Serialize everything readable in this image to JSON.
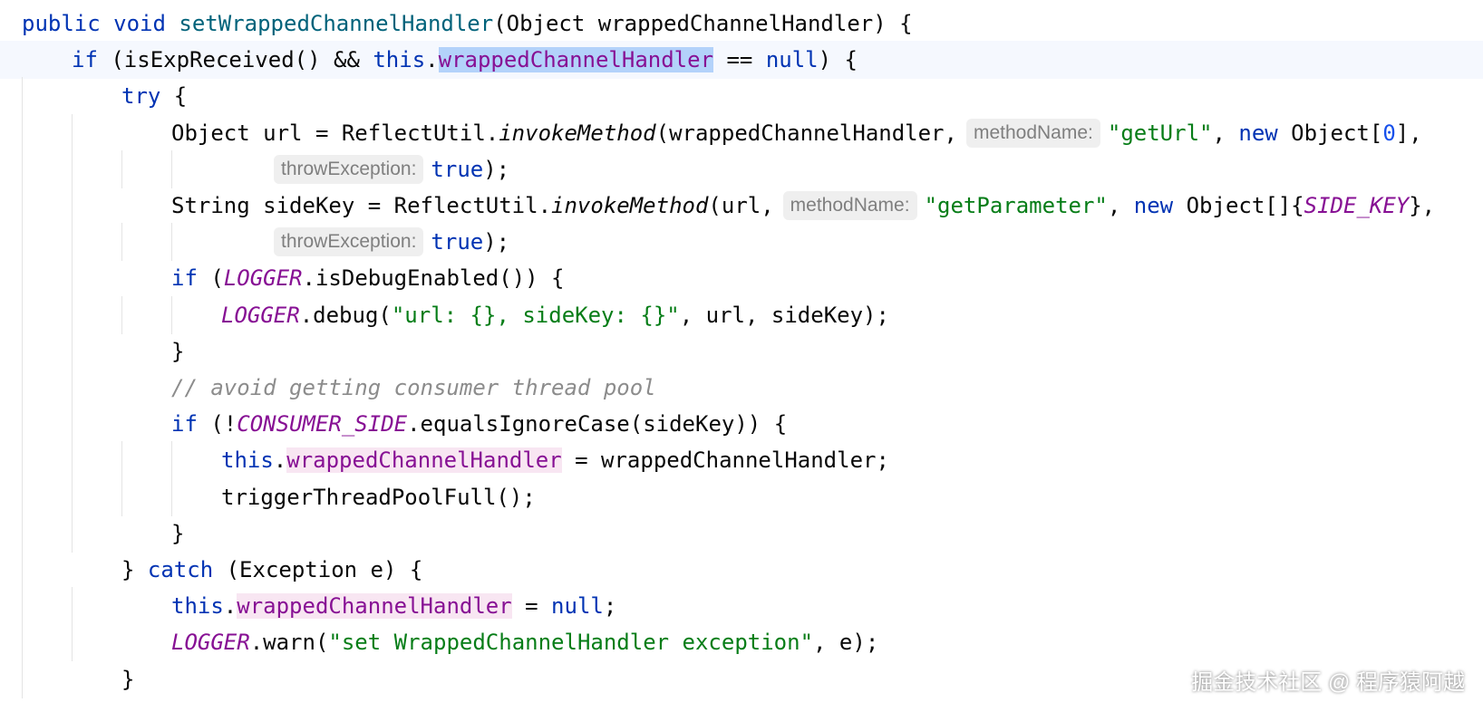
{
  "editor": {
    "lines": [
      {
        "segments": [
          {
            "t": "public",
            "c": "kw"
          },
          {
            "t": " "
          },
          {
            "t": "void",
            "c": "kw"
          },
          {
            "t": " "
          },
          {
            "t": "setWrappedChannelHandler",
            "c": "fn"
          },
          {
            "t": "(Object wrappedChannelHandler) {"
          }
        ]
      },
      {
        "current": true,
        "segments": [
          {
            "t": "if",
            "c": "kw"
          },
          {
            "t": " (isExpReceived() && "
          },
          {
            "t": "this",
            "c": "kw"
          },
          {
            "t": "."
          },
          {
            "t": "wrappedChannelHandler",
            "c": "fld sel"
          },
          {
            "t": " == "
          },
          {
            "t": "null",
            "c": "kw"
          },
          {
            "t": ") {"
          }
        ]
      },
      {
        "segments": [
          {
            "t": "try",
            "c": "kw"
          },
          {
            "t": " {"
          }
        ]
      },
      {
        "segments": [
          {
            "t": "Object url = ReflectUtil."
          },
          {
            "t": "invokeMethod",
            "c": "it"
          },
          {
            "t": "(wrappedChannelHandler,"
          },
          {
            "t": "methodName:",
            "c": "hint"
          },
          {
            "t": "\"getUrl\"",
            "c": "str"
          },
          {
            "t": ", "
          },
          {
            "t": "new",
            "c": "kw"
          },
          {
            "t": " Object["
          },
          {
            "t": "0",
            "c": "num"
          },
          {
            "t": "],"
          }
        ]
      },
      {
        "segments": [
          {
            "t": "throwException:",
            "c": "hint first"
          },
          {
            "t": "true",
            "c": "kw"
          },
          {
            "t": ");"
          }
        ]
      },
      {
        "segments": [
          {
            "t": "String sideKey = ReflectUtil."
          },
          {
            "t": "invokeMethod",
            "c": "it"
          },
          {
            "t": "(url,"
          },
          {
            "t": "methodName:",
            "c": "hint"
          },
          {
            "t": "\"getParameter\"",
            "c": "str"
          },
          {
            "t": ", "
          },
          {
            "t": "new",
            "c": "kw"
          },
          {
            "t": " Object[]{"
          },
          {
            "t": "SIDE_KEY",
            "c": "cnst"
          },
          {
            "t": "},"
          }
        ]
      },
      {
        "segments": [
          {
            "t": "throwException:",
            "c": "hint first"
          },
          {
            "t": "true",
            "c": "kw"
          },
          {
            "t": ");"
          }
        ]
      },
      {
        "segments": [
          {
            "t": "if",
            "c": "kw"
          },
          {
            "t": " ("
          },
          {
            "t": "LOGGER",
            "c": "cnst"
          },
          {
            "t": ".isDebugEnabled()) {"
          }
        ]
      },
      {
        "segments": [
          {
            "t": "LOGGER",
            "c": "cnst"
          },
          {
            "t": ".debug("
          },
          {
            "t": "\"url: {}, sideKey: {}\"",
            "c": "str"
          },
          {
            "t": ", url, sideKey);"
          }
        ]
      },
      {
        "segments": [
          {
            "t": "}"
          }
        ]
      },
      {
        "segments": [
          {
            "t": "// avoid getting consumer thread pool",
            "c": "cm"
          }
        ]
      },
      {
        "segments": [
          {
            "t": "if",
            "c": "kw"
          },
          {
            "t": " (!"
          },
          {
            "t": "CONSUMER_SIDE",
            "c": "cnst"
          },
          {
            "t": ".equalsIgnoreCase(sideKey)) {"
          }
        ]
      },
      {
        "segments": [
          {
            "t": "this",
            "c": "kw"
          },
          {
            "t": "."
          },
          {
            "t": "wrappedChannelHandler",
            "c": "fld wr"
          },
          {
            "t": " = wrappedChannelHandler;"
          }
        ]
      },
      {
        "segments": [
          {
            "t": "triggerThreadPoolFull();"
          }
        ]
      },
      {
        "segments": [
          {
            "t": "}"
          }
        ]
      },
      {
        "segments": [
          {
            "t": "} "
          },
          {
            "t": "catch",
            "c": "kw"
          },
          {
            "t": " (Exception e) {"
          }
        ]
      },
      {
        "segments": [
          {
            "t": "this",
            "c": "kw"
          },
          {
            "t": "."
          },
          {
            "t": "wrappedChannelHandler",
            "c": "fld wr"
          },
          {
            "t": " = "
          },
          {
            "t": "null",
            "c": "kw"
          },
          {
            "t": ";"
          }
        ]
      },
      {
        "segments": [
          {
            "t": "LOGGER",
            "c": "cnst"
          },
          {
            "t": ".warn("
          },
          {
            "t": "\"set WrappedChannelHandler exception\"",
            "c": "str"
          },
          {
            "t": ", e);"
          }
        ]
      },
      {
        "segments": [
          {
            "t": "}"
          }
        ]
      }
    ]
  },
  "watermark": "掘金技术社区 @ 程序猿阿越"
}
